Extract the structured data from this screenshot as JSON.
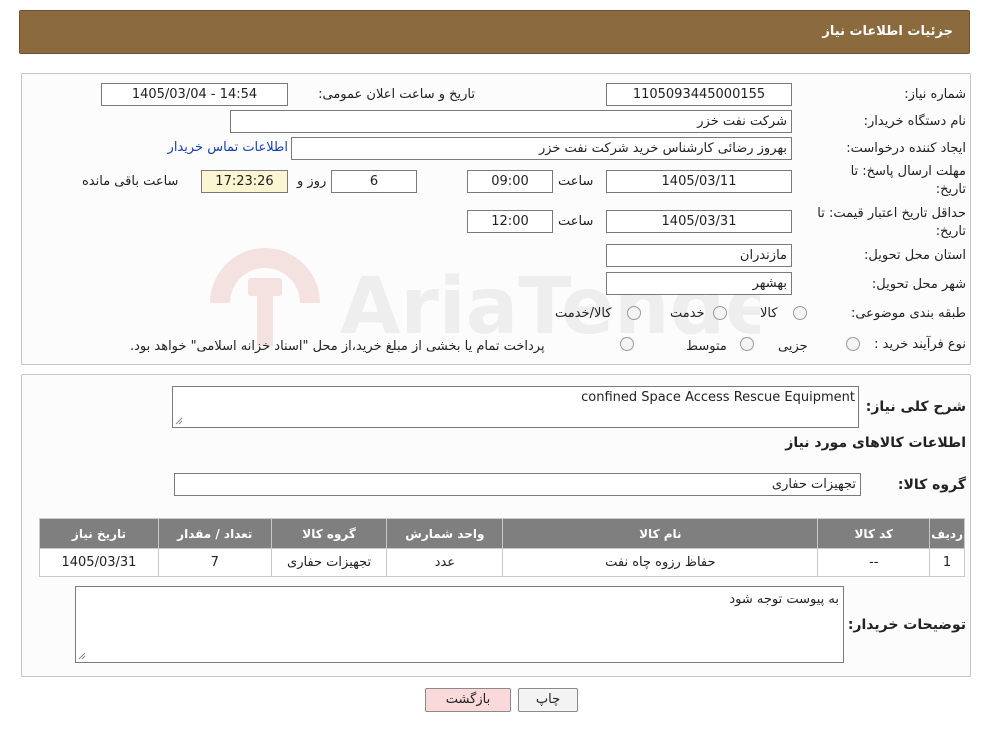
{
  "header": {
    "title": "جزئیات اطلاعات نیاز"
  },
  "form": {
    "need_number_label": "شماره نیاز:",
    "need_number": "1105093445000155",
    "announce_label": "تاریخ و ساعت اعلان عمومی:",
    "announce_value": "1405/03/04 - 14:54",
    "buyer_org_label": "نام دستگاه خریدار:",
    "buyer_org": "شرکت نفت خزر",
    "creator_label": "ایجاد کننده درخواست:",
    "creator": "بهروز رضائی کارشناس خرید شرکت نفت خزر",
    "contact_link": "اطلاعات تماس خریدار",
    "deadline_label_1": "مهلت ارسال پاسخ: تا",
    "deadline_label_2": "تاریخ:",
    "deadline_date": "1405/03/11",
    "time_label": "ساعت",
    "deadline_time": "09:00",
    "days_value": "6",
    "days_label": "روز و",
    "remaining_time": "17:23:26",
    "remaining_label": "ساعت باقی مانده",
    "validity_label_1": "حداقل تاریخ اعتبار قیمت: تا",
    "validity_label_2": "تاریخ:",
    "validity_date": "1405/03/31",
    "validity_time": "12:00",
    "province_label": "استان محل تحویل:",
    "province": "مازندران",
    "city_label": "شهر محل تحویل:",
    "city": "بهشهر",
    "category_label": "طبقه بندی موضوعی:",
    "category_options": [
      "کالا",
      "خدمت",
      "کالا/خدمت"
    ],
    "process_label": "نوع فرآیند خرید :",
    "process_options": [
      "جزیی",
      "متوسط"
    ],
    "process_note": "پرداخت تمام یا بخشی از مبلغ خرید،از محل \"اسناد خزانه اسلامی\" خواهد بود."
  },
  "summary": {
    "desc_label": "شرح کلی نیاز:",
    "desc_value": "confined Space Access Rescue Equipment",
    "items_title": "اطلاعات کالاهای مورد نیاز",
    "group_label": "گروه کالا:",
    "group_value": "تجهیزات حفاری"
  },
  "table": {
    "headers": [
      "ردیف",
      "کد کالا",
      "نام کالا",
      "واحد شمارش",
      "گروه کالا",
      "تعداد / مقدار",
      "تاریخ نیاز"
    ],
    "rows": [
      [
        "1",
        "--",
        "حفاظ رزوه چاه نفت",
        "عدد",
        "تجهیزات حفاری",
        "7",
        "1405/03/31"
      ]
    ]
  },
  "buyer_notes": {
    "label": "توضیحات خریدار:",
    "value": "به پیوست توجه شود"
  },
  "buttons": {
    "print": "چاپ",
    "back": "بازگشت"
  },
  "watermark": {
    "text": "AriaTender.neT"
  },
  "colors": {
    "header_bg": "#8b6a3e",
    "table_header_bg": "#7f7f7f",
    "highlight": "#fbf5d2",
    "back_button": "#f9d9d9"
  }
}
